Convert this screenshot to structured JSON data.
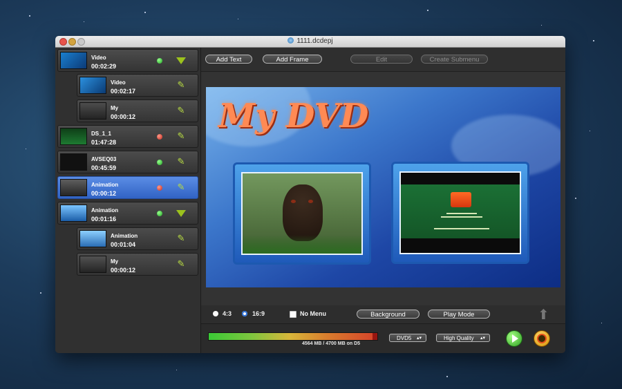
{
  "window": {
    "title": "1111.dcdepj"
  },
  "sidebar": {
    "items": [
      {
        "name": "Video",
        "time": "00:02:29",
        "status": "green",
        "action": "expand-triangle",
        "thumb_icon": "video-thumbnail-icon"
      },
      {
        "name": "Video",
        "time": "00:02:17",
        "action": "edit-pencil",
        "thumb_icon": "video-thumbnail-icon"
      },
      {
        "name": "My",
        "time": "00:00:12",
        "action": "edit-pencil",
        "thumb_icon": "dog-thumbnail-icon"
      },
      {
        "name": "DS_1_1",
        "time": "01:47:28",
        "status": "red",
        "action": "edit-pencil",
        "thumb_icon": "video-thumbnail-icon"
      },
      {
        "name": "AVSEQ03",
        "time": "00:45:59",
        "status": "green",
        "action": "edit-pencil",
        "thumb_icon": "video-thumbnail-icon"
      },
      {
        "name": "Animation",
        "time": "00:00:12",
        "status": "red",
        "action": "edit-pencil",
        "thumb_icon": "dog-thumbnail-icon"
      },
      {
        "name": "Animation",
        "time": "00:01:16",
        "status": "green",
        "action": "expand-triangle",
        "thumb_icon": "landscape-thumbnail-icon"
      },
      {
        "name": "Animation",
        "time": "00:01:04",
        "action": "edit-pencil",
        "thumb_icon": "landscape-thumbnail-icon"
      },
      {
        "name": "My",
        "time": "00:00:12",
        "action": "edit-pencil",
        "thumb_icon": "dog-thumbnail-icon"
      }
    ],
    "selected_index": 5
  },
  "toolbar": {
    "add_text": "Add Text",
    "add_frame": "Add Frame",
    "edit": "Edit",
    "create_submenu": "Create Submenu"
  },
  "preview": {
    "title_text": "My DVD"
  },
  "options": {
    "aspect_4_3": "4:3",
    "aspect_16_9": "16:9",
    "no_menu": "No Menu",
    "background": "Background",
    "play_mode": "Play Mode"
  },
  "footer": {
    "capacity_text": "4564 MB / 4700 MB on D5",
    "capacity_fraction": 0.971,
    "format_select": "DVD5",
    "quality_select": "High Quality"
  },
  "colors": {
    "selected_row": "#3c73d8",
    "accent_green": "#2fb12f",
    "accent_red": "#d63a2c"
  }
}
